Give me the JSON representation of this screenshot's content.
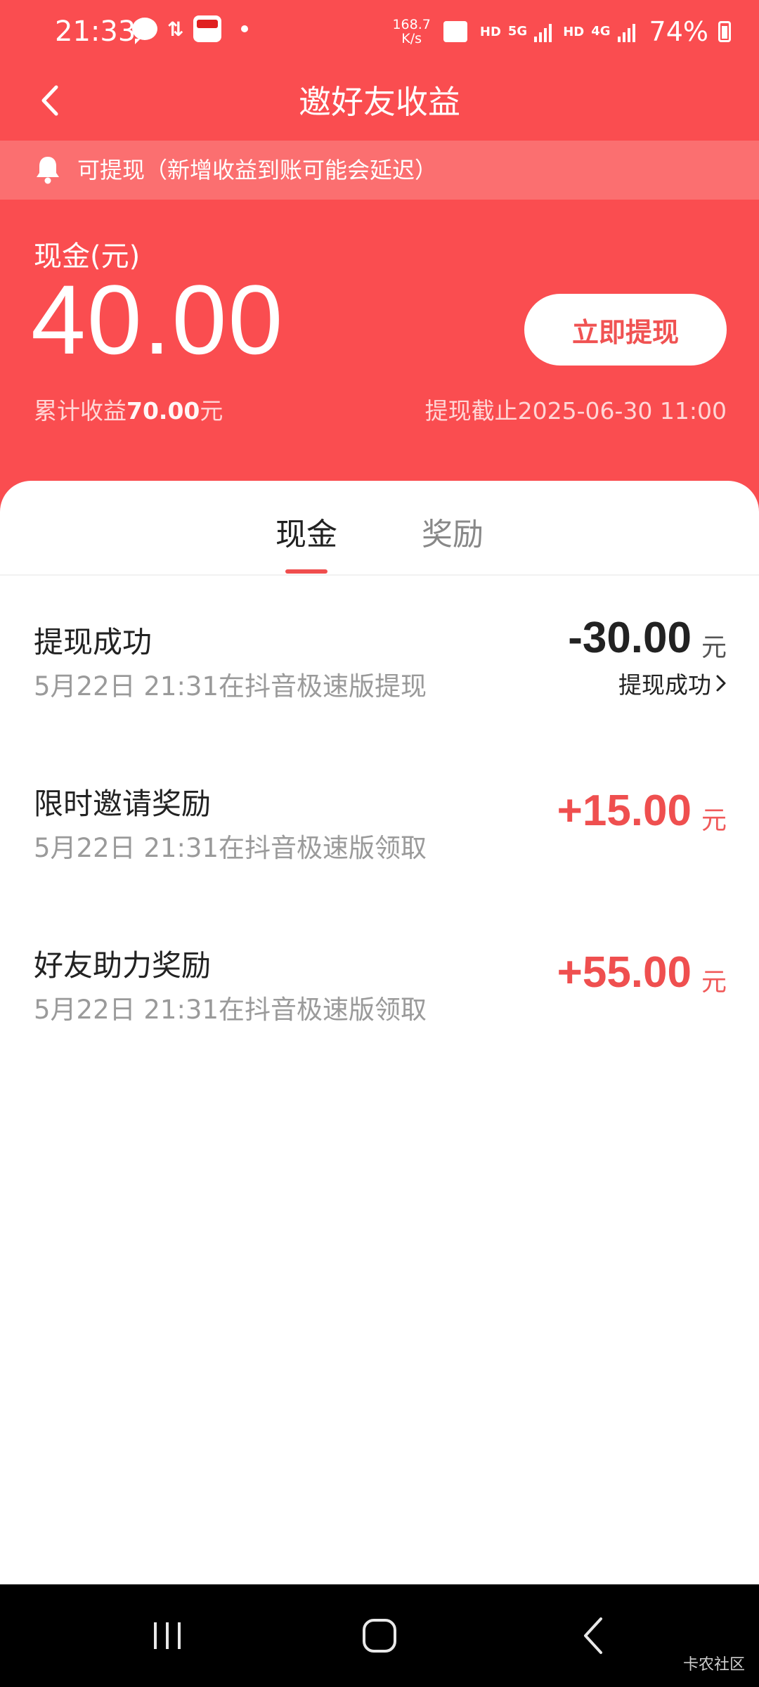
{
  "status_bar": {
    "time": "21:33",
    "speed_value": "168.7",
    "speed_unit": "K/s",
    "hd1": "HD",
    "net1_type": "5G",
    "hd2": "HD",
    "net2_type": "4G",
    "battery": "74%"
  },
  "header": {
    "title": "邀好友收益"
  },
  "notice": {
    "text": "可提现（新增收益到账可能会延迟）"
  },
  "balance": {
    "label": "现金(元)",
    "amount": "40.00",
    "withdraw_button": "立即提现",
    "cumulative_prefix": "累计收益",
    "cumulative_value": "70.00",
    "cumulative_suffix": "元",
    "deadline": "提现截止2025-06-30 11:00"
  },
  "tabs": {
    "cash": "现金",
    "reward": "奖励"
  },
  "records": [
    {
      "title": "提现成功",
      "subtitle": "5月22日 21:31在抖音极速版提现",
      "amount": "-30.00",
      "unit": "元",
      "status": "提现成功"
    },
    {
      "title": "限时邀请奖励",
      "subtitle": "5月22日 21:31在抖音极速版领取",
      "amount": "+15.00",
      "unit": "元"
    },
    {
      "title": "好友助力奖励",
      "subtitle": "5月22日 21:31在抖音极速版领取",
      "amount": "+55.00",
      "unit": "元"
    }
  ],
  "watermark": "卡农社区",
  "colors": {
    "header_red": "#fa4d50",
    "positive_amount": "#ef4f4f",
    "negative_amount": "#222222"
  }
}
